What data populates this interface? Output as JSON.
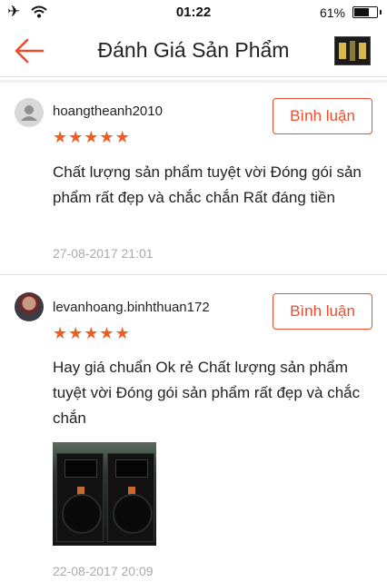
{
  "status_bar": {
    "time": "01:22",
    "battery_pct": "61%",
    "battery_level": 0.61
  },
  "header": {
    "title": "Đánh Giá Sản Phẩm",
    "back_icon": "arrow-left-icon",
    "accent_color": "#ee4d2d"
  },
  "reviews": [
    {
      "username": "hoangtheanh2010",
      "rating": 5,
      "comment": "Chất lượng sản phẩm tuyệt vời Đóng gói sản phẩm rất đẹp và chắc chắn Rất đáng tiền",
      "date": "27-08-2017 21:01",
      "button_label": "Bình luận"
    },
    {
      "username": "levanhoang.binhthuan172",
      "rating": 5,
      "comment": "Hay giá chuẩn Ok rẻ Chất lượng sản phẩm tuyệt vời Đóng gói sản phẩm rất đẹp và chắc chắn",
      "date": "22-08-2017 20:09",
      "button_label": "Bình luận"
    }
  ]
}
